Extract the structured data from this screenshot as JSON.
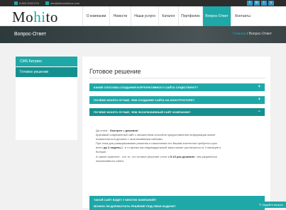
{
  "topbar": {
    "phone": "8 800 3333 576",
    "email": "info@sitesolutions.com",
    "socials": [
      "f",
      "in",
      "t",
      "v"
    ]
  },
  "logo": {
    "pre": "Mo",
    "hi": "hi",
    "post": "to"
  },
  "nav": [
    "О компании",
    "Новости",
    "Наши услуги",
    "Каталог",
    "Портфолио",
    "Вопрос-Ответ",
    "Контакты"
  ],
  "banner": {
    "title": "Вопрос-Ответ",
    "crumb_home": "Главная",
    "crumb_sep": "/",
    "crumb_current": "Вопрос-Ответ"
  },
  "sidebar": [
    "CMS Битрикс",
    "Готовое решение"
  ],
  "main": {
    "title": "Готовое решение",
    "questions": [
      "КАКИЕ СПОСОБЫ СОЗДАНИЯ КОРПОРАТИВНОГО САЙТА СУЩЕСТВУЮТ?",
      "ПОЧЕМУ MOHITO ЛУЧШЕ, ЧЕМ СОЗДАНИЕ САЙТА НА КОНСТРУКТОРЕ?",
      "ПОЧЕМУ MOHITO ЛУЧШЕ, ЧЕМ ЭКСКЛЮЗИВНЫЙ САЙТ КОМПАНИИ?",
      "МОЖНО ЛИ ДОРАБОТАТЬ РЕШЕНИЕ ПОД СВОИ ЗАДАЧИ?",
      "ТАКОЙ САЙТ БУДЕТ У МНОГИХ КОМПАНИЙ?"
    ],
    "plus": "+",
    "minus": "−",
    "answer": {
      "l1_pre": "Да столе - ",
      "l1_b1": "быстрее",
      "l1_mid": " и ",
      "l1_b2": "дешевле",
      "l1_post": "!",
      "l2": "Красивый современный сайт с множеством способов предоставления информации может",
      "l3": "похвастаться в десятки с эксклюзивными сайтами.",
      "l4": "При этом для разворачивания решения и наполнения его Вашим контентом требуется срок",
      "l5_pre": "всего ",
      "l5_b": "до 2 недель",
      "l5_post": "(1, в то время как индивидуальный заказ может растянуться от 2 месяцев и",
      "l6": "больше.",
      "l7_pre": "А самое приятное - это то, что готовое решение стоит в ",
      "l7_b": "5-10 раз дешевле",
      "l7_post": ", чем разработка",
      "l8": "эксклюзивного сайта."
    }
  },
  "badge": "Задайте вопрос"
}
